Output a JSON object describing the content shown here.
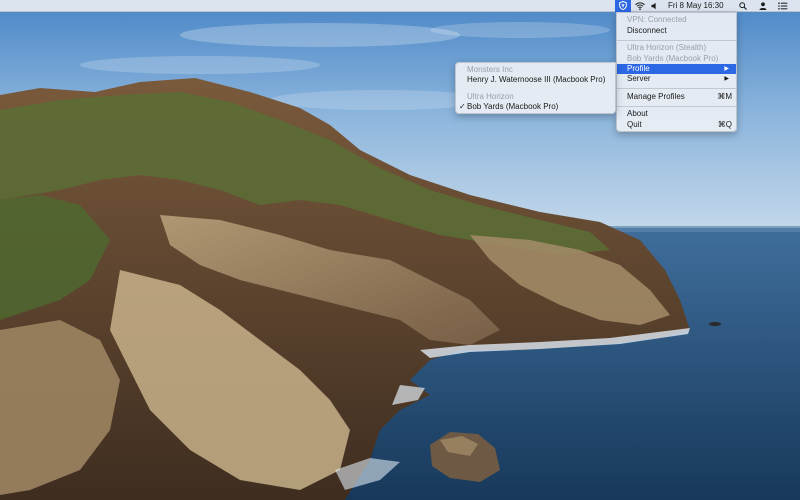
{
  "menubar": {
    "clock": "Fri 8 May  16:30",
    "icons": [
      "vpn-shield-icon",
      "wifi-icon",
      "volume-icon",
      "search-icon",
      "user-icon",
      "list-icon"
    ]
  },
  "menu": {
    "status": "VPN: Connected",
    "disconnect": "Disconnect",
    "current_server": "Ultra Horizon (Stealth)",
    "current_profile": "Bob Yards (Macbook Pro)",
    "profile": "Profile",
    "server": "Server",
    "manage_profiles": "Manage Profiles",
    "manage_profiles_shortcut": "⌘M",
    "about": "About",
    "quit": "Quit",
    "quit_shortcut": "⌘Q"
  },
  "submenu": {
    "group1_header": "Monsters Inc",
    "group1_item": "Henry J. Waternoose III (Macbook Pro)",
    "group2_header": "Ultra Horizon",
    "group2_item": "Bob Yards (Macbook Pro)",
    "checkmark": "✓"
  },
  "colors": {
    "highlight": "#2c67e4",
    "menu_bg": "#eaeef4",
    "disabled_text": "#9aa0a8"
  }
}
